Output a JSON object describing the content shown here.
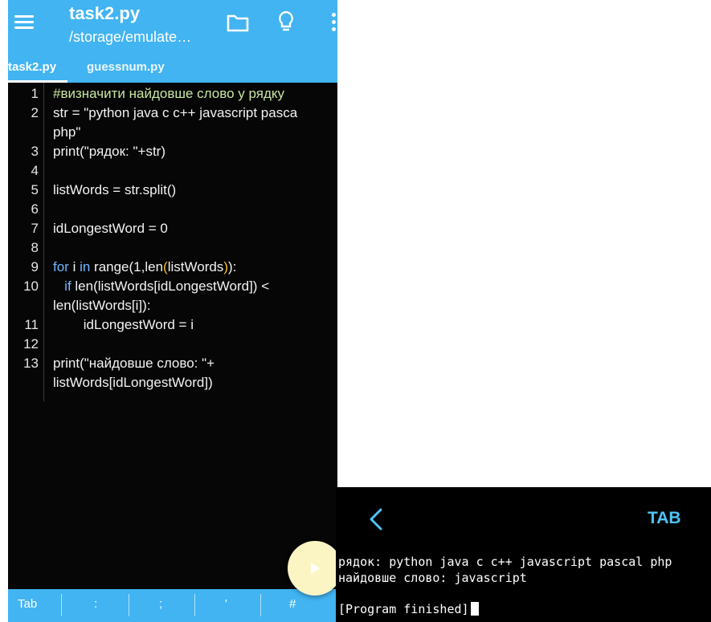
{
  "editor": {
    "title": "task2.py",
    "subtitle": "/storage/emulate…",
    "tabs": [
      {
        "label": "task2.py",
        "active": true
      },
      {
        "label": "guessnum.py",
        "active": false
      }
    ],
    "code": {
      "l1": "#визначити найдовше слово у рядку",
      "l2": "str = \"python java c c++ javascript pasca",
      "l2b": "php\"",
      "l3": "print(\"рядок: \"+str)",
      "l5": "listWords = str.split()",
      "l7": "idLongestWord = 0",
      "l9a": "for",
      "l9b": " i ",
      "l9c": "in",
      "l9d": " range(1,len",
      "l9e": "(",
      "l9f": "listWords",
      "l9g": ")",
      "l9h": "):",
      "l10a": "   ",
      "l10b": "if",
      "l10c": " len(listWords[idLongestWord]) <",
      "l10d": "len(listWords[i]):",
      "l11": "        idLongestWord = i",
      "l13": "print(\"найдовше слово: \"+",
      "l13b": "listWords[idLongestWord])"
    },
    "line_numbers": [
      "1",
      "2",
      "3",
      "4",
      "5",
      "6",
      "7",
      "8",
      "9",
      "10",
      "11",
      "12",
      "13"
    ],
    "keys": [
      "Tab",
      ":",
      ";",
      "'",
      "#"
    ],
    "colors": {
      "accent": "#42b4f1",
      "code_bg": "#060606",
      "fab": "#fbf5c4"
    }
  },
  "terminal": {
    "tab_label": "TAB",
    "lines": [
      "рядок: python java c c++ javascript pascal php",
      "найдовше слово: javascript",
      "[Program finished]"
    ],
    "colors": {
      "accent": "#4fc3f7",
      "bg": "#000000"
    }
  }
}
